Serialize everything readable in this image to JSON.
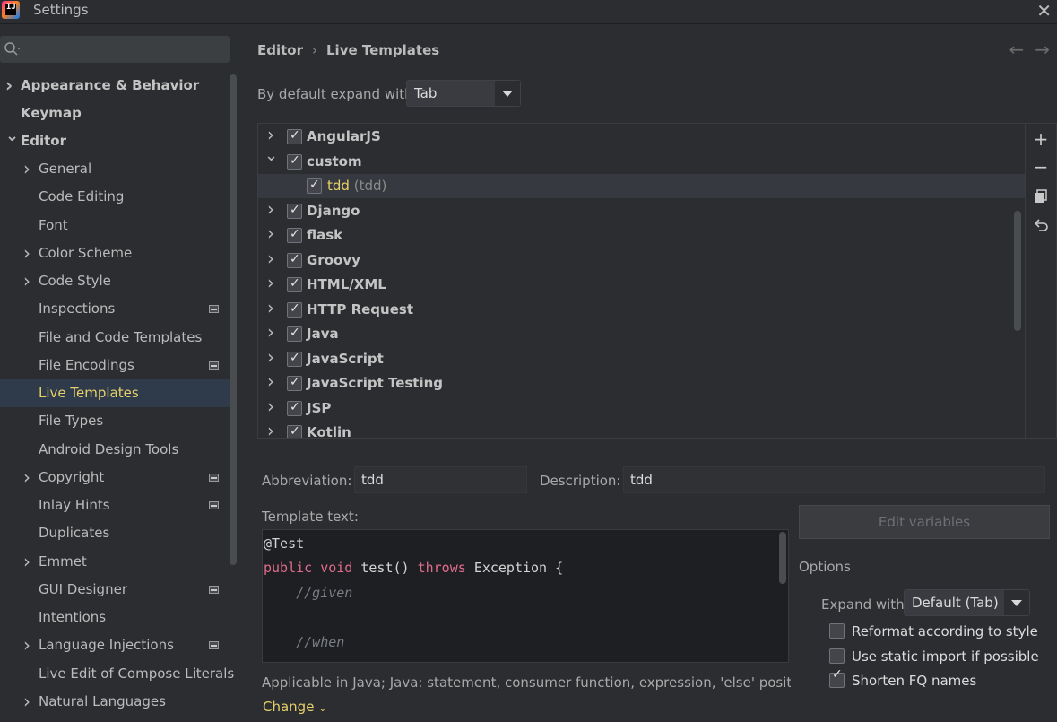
{
  "window": {
    "title": "Settings",
    "app_icon": "intellij-icon",
    "close_icon": "close-icon"
  },
  "search": {
    "placeholder": "",
    "icon": "search-icon"
  },
  "sidebar": {
    "items": [
      {
        "label": "Appearance & Behavior",
        "bold": true,
        "chevron": "right"
      },
      {
        "label": "Keymap",
        "bold": true,
        "chevron": ""
      },
      {
        "label": "Editor",
        "bold": true,
        "chevron": "down"
      },
      {
        "label": "General",
        "chevron": "right"
      },
      {
        "label": "Code Editing",
        "chevron": ""
      },
      {
        "label": "Font",
        "chevron": ""
      },
      {
        "label": "Color Scheme",
        "chevron": "right"
      },
      {
        "label": "Code Style",
        "chevron": "right"
      },
      {
        "label": "Inspections",
        "chevron": "",
        "project_icon": true
      },
      {
        "label": "File and Code Templates",
        "chevron": ""
      },
      {
        "label": "File Encodings",
        "chevron": "",
        "project_icon": true
      },
      {
        "label": "Live Templates",
        "chevron": "",
        "selected": true
      },
      {
        "label": "File Types",
        "chevron": ""
      },
      {
        "label": "Android Design Tools",
        "chevron": ""
      },
      {
        "label": "Copyright",
        "chevron": "right",
        "project_icon": true
      },
      {
        "label": "Inlay Hints",
        "chevron": "",
        "project_icon": true
      },
      {
        "label": "Duplicates",
        "chevron": ""
      },
      {
        "label": "Emmet",
        "chevron": "right"
      },
      {
        "label": "GUI Designer",
        "chevron": "",
        "project_icon": true
      },
      {
        "label": "Intentions",
        "chevron": ""
      },
      {
        "label": "Language Injections",
        "chevron": "right",
        "project_icon": true
      },
      {
        "label": "Live Edit of Compose Literals",
        "chevron": ""
      },
      {
        "label": "Natural Languages",
        "chevron": "right"
      }
    ]
  },
  "breadcrumb": {
    "parent": "Editor",
    "separator": "›",
    "current": "Live Templates"
  },
  "nav": {
    "back": "←",
    "forward": "→"
  },
  "expand_default": {
    "label": "By default expand with",
    "value": "Tab"
  },
  "template_groups": [
    {
      "label": "AngularJS",
      "checked": true,
      "chevron": "right"
    },
    {
      "label": "custom",
      "checked": true,
      "chevron": "down"
    },
    {
      "label": "tdd",
      "sub": "(tdd)",
      "checked": true,
      "child": true,
      "selected": true
    },
    {
      "label": "Django",
      "checked": true,
      "chevron": "right"
    },
    {
      "label": "flask",
      "checked": true,
      "chevron": "right"
    },
    {
      "label": "Groovy",
      "checked": true,
      "chevron": "right"
    },
    {
      "label": "HTML/XML",
      "checked": true,
      "chevron": "right"
    },
    {
      "label": "HTTP Request",
      "checked": true,
      "chevron": "right"
    },
    {
      "label": "Java",
      "checked": true,
      "chevron": "right"
    },
    {
      "label": "JavaScript",
      "checked": true,
      "chevron": "right"
    },
    {
      "label": "JavaScript Testing",
      "checked": true,
      "chevron": "right"
    },
    {
      "label": "JSP",
      "checked": true,
      "chevron": "right"
    },
    {
      "label": "Kotlin",
      "checked": true,
      "chevron": "right"
    }
  ],
  "toolbar": {
    "add": "+",
    "remove": "−",
    "copy_icon": "copy-icon",
    "restore_icon": "restore-icon"
  },
  "details": {
    "abbreviation_label": "Abbreviation:",
    "abbreviation_value": "tdd",
    "description_label": "Description:",
    "description_value": "tdd",
    "template_text_label": "Template text:",
    "edit_variables": "Edit variables",
    "options_title": "Options",
    "expand_with_label": "Expand with",
    "expand_with_value": "Default (Tab)",
    "options": [
      {
        "label": "Reformat according to style",
        "checked": false
      },
      {
        "label": "Use static import if possible",
        "checked": false
      },
      {
        "label": "Shorten FQ names",
        "checked": true
      }
    ],
    "applicable": "Applicable in Java; Java: statement, consumer function, expression, 'else' position, declaration",
    "change": "Change"
  },
  "code": {
    "line1": "@Test",
    "line2_kw1": "public",
    "line2_kw2": "void",
    "line2_name": "test()",
    "line2_kw3": "throws",
    "line2_rest": "Exception {",
    "line3": "    //given",
    "line5": "    //when"
  }
}
